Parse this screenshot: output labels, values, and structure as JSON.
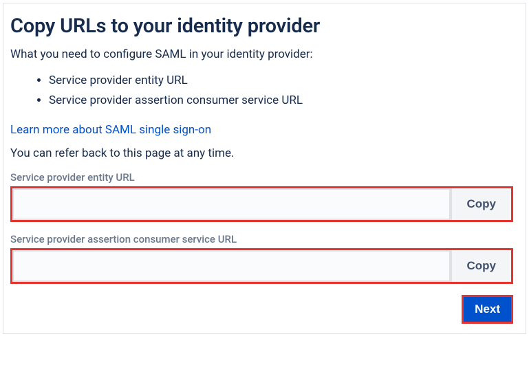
{
  "heading": "Copy URLs to your identity provider",
  "intro": "What you need to configure SAML in your identity provider:",
  "bullets": [
    "Service provider entity URL",
    "Service provider assertion consumer service URL"
  ],
  "learn_more": "Learn more about SAML single sign-on",
  "refer_text": "You can refer back to this page at any time.",
  "fields": [
    {
      "label": "Service provider entity URL",
      "value": "",
      "copy_label": "Copy"
    },
    {
      "label": "Service provider assertion consumer service URL",
      "value": "",
      "copy_label": "Copy"
    }
  ],
  "next_label": "Next"
}
